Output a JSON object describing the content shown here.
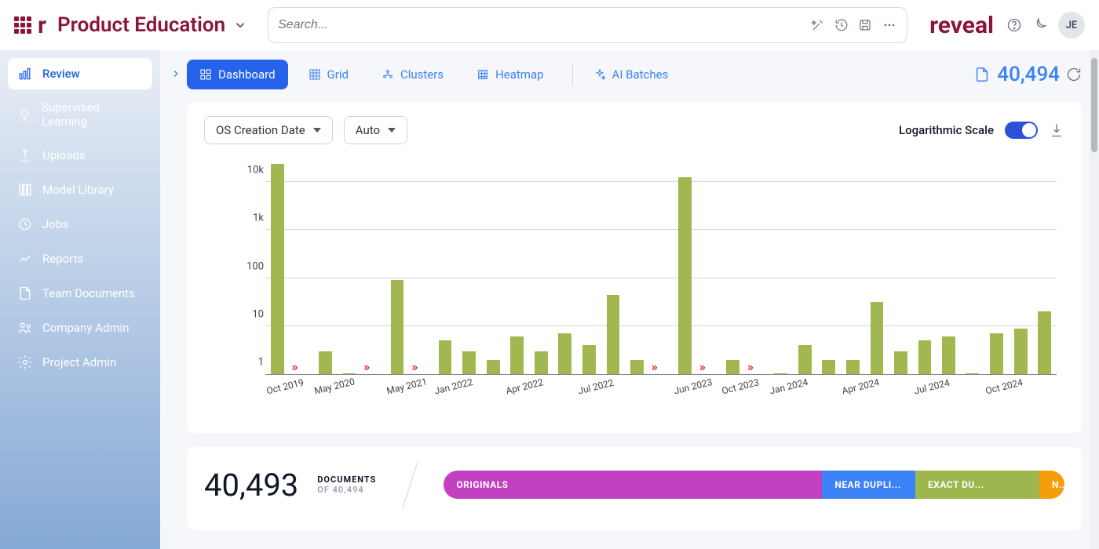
{
  "header": {
    "project_name": "Product Education",
    "search_placeholder": "Search...",
    "brand_word": "reveal",
    "avatar_initials": "JE"
  },
  "sidebar": {
    "items": [
      {
        "label": "Review",
        "icon": "bar-chart-icon",
        "active": true
      },
      {
        "label": "Supervised Learning",
        "icon": "bulb-icon"
      },
      {
        "label": "Uploads",
        "icon": "upload-icon"
      },
      {
        "label": "Model Library",
        "icon": "library-icon"
      },
      {
        "label": "Jobs",
        "icon": "clock-icon"
      },
      {
        "label": "Reports",
        "icon": "line-chart-icon"
      },
      {
        "label": "Team Documents",
        "icon": "file-icon"
      },
      {
        "label": "Company Admin",
        "icon": "people-icon"
      },
      {
        "label": "Project Admin",
        "icon": "gear-icon"
      }
    ]
  },
  "tabs": {
    "items": [
      {
        "label": "Dashboard",
        "icon": "widgets-icon",
        "active": true
      },
      {
        "label": "Grid",
        "icon": "grid-icon"
      },
      {
        "label": "Clusters",
        "icon": "cluster-icon"
      },
      {
        "label": "Heatmap",
        "icon": "heatmap-icon"
      },
      {
        "label": "AI Batches",
        "icon": "sparkle-icon",
        "sep_before": true
      }
    ],
    "doc_count": "40,494"
  },
  "chart_controls": {
    "field_select": "OS Creation Date",
    "interval_select": "Auto",
    "log_toggle_label": "Logarithmic Scale",
    "log_toggle_on": true
  },
  "chart_data": {
    "type": "bar",
    "ylabel": "",
    "xlabel": "",
    "yscale": "log",
    "ylim": [
      1,
      30000
    ],
    "yticks": [
      1,
      10,
      100,
      "1k",
      "10k"
    ],
    "bar_values": [
      24000,
      3,
      1,
      90,
      5,
      3,
      2,
      6,
      3,
      7,
      4,
      45,
      2,
      12500,
      2,
      1,
      4,
      2,
      2,
      32,
      3,
      5,
      6,
      1,
      7,
      9,
      20
    ],
    "gap_after_index": [
      0,
      2,
      3,
      12,
      13,
      14
    ],
    "x_tick_labels": [
      {
        "at": 0,
        "label": "Oct 2019"
      },
      {
        "at": 1,
        "label": "May 2020"
      },
      {
        "at": 3,
        "label": "May 2021"
      },
      {
        "at": 4,
        "label": "Jan 2022"
      },
      {
        "at": 7,
        "label": "Apr 2022"
      },
      {
        "at": 10,
        "label": "Jul 2022"
      },
      {
        "at": 13,
        "label": "Jun 2023"
      },
      {
        "at": 14,
        "label": "Oct 2023"
      },
      {
        "at": 15,
        "label": "Jan 2024"
      },
      {
        "at": 18,
        "label": "Apr 2024"
      },
      {
        "at": 21,
        "label": "Jul 2024"
      },
      {
        "at": 24,
        "label": "Oct 2024"
      }
    ]
  },
  "summary": {
    "count": "40,493",
    "count_label": "DOCUMENTS",
    "of_label": "OF 40,494",
    "segments": [
      {
        "label": "ORIGINALS",
        "pct": 61,
        "color": "#c241c2"
      },
      {
        "label": "NEAR DUPLI...",
        "pct": 15,
        "color": "#3b82f6"
      },
      {
        "label": "EXACT DU...",
        "pct": 20,
        "color": "#9bb74d"
      },
      {
        "label": "N...",
        "pct": 4,
        "color": "#f59e0b"
      }
    ]
  }
}
